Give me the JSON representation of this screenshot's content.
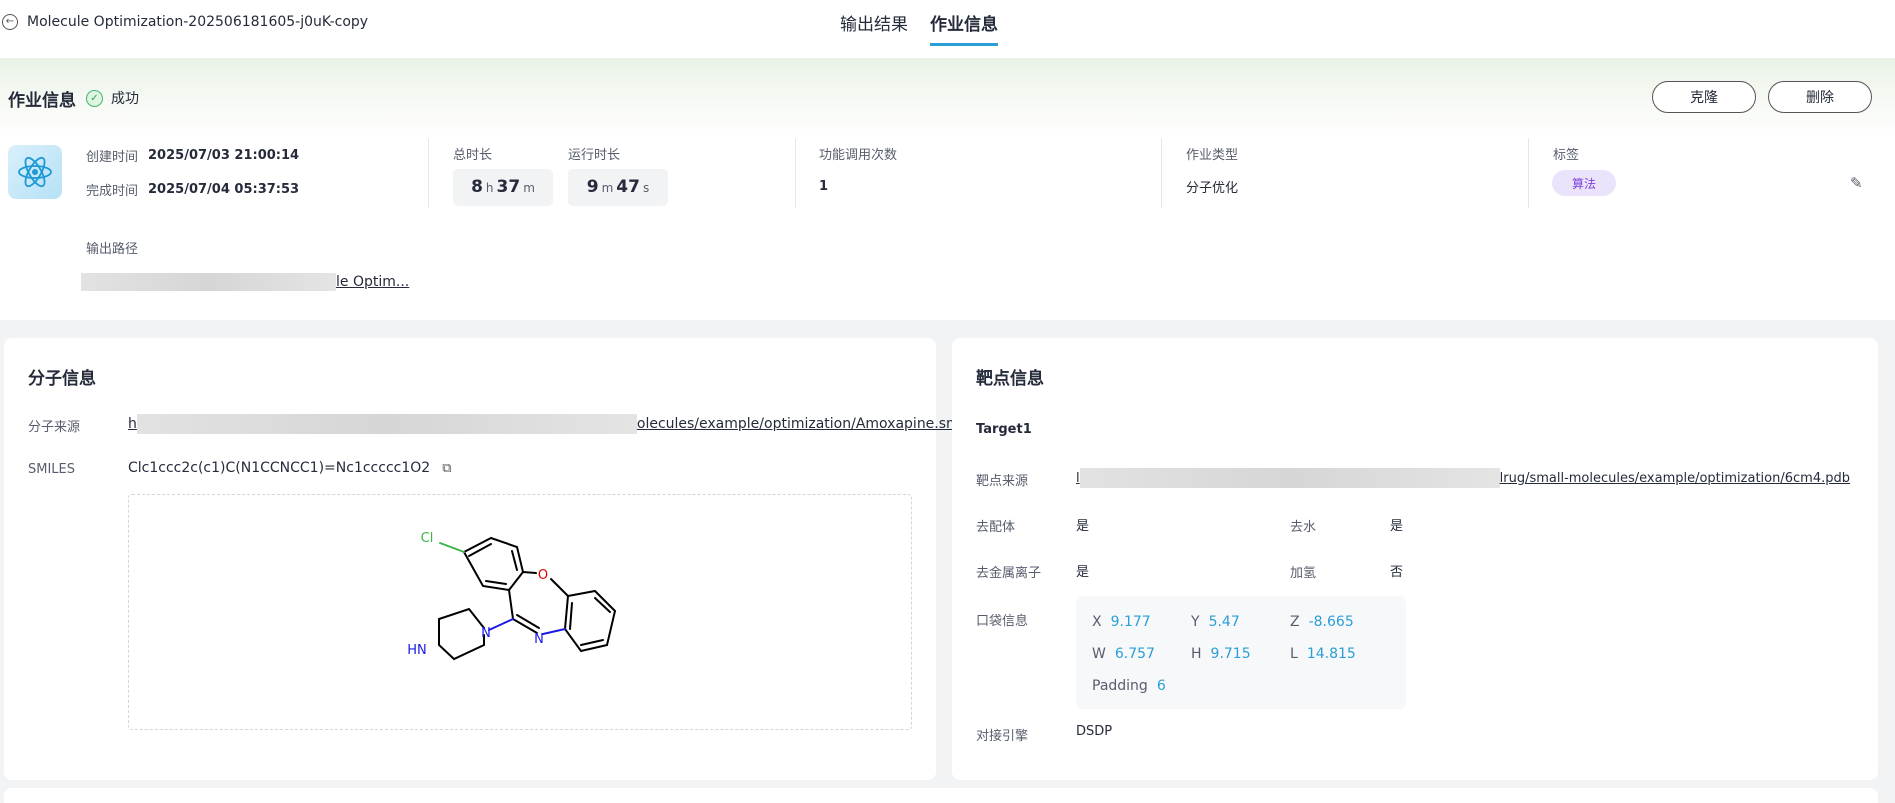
{
  "header": {
    "back_title": "Molecule Optimization-202506181605-j0uK-copy",
    "tabs": [
      {
        "label": "输出结果",
        "active": false
      },
      {
        "label": "作业信息",
        "active": true
      }
    ]
  },
  "job": {
    "title": "作业信息",
    "status": "成功",
    "status_color": "#3fb86a",
    "clone_label": "克隆",
    "delete_label": "删除",
    "icon": "atom-icon",
    "created_label": "创建时间",
    "created_value": "2025/07/03 21:00:14",
    "finished_label": "完成时间",
    "finished_value": "2025/07/04 05:37:53",
    "total_duration_label": "总时长",
    "total_duration": {
      "h": "8",
      "h_unit": "h",
      "m": "37",
      "m_unit": "m"
    },
    "run_duration_label": "运行时长",
    "run_duration": {
      "m": "9",
      "m_unit": "m",
      "s": "47",
      "s_unit": "s"
    },
    "calls_label": "功能调用次数",
    "calls_value": "1",
    "type_label": "作业类型",
    "type_value": "分子优化",
    "tags_label": "标签",
    "tag": "算法",
    "tag_color": "#7a45d8",
    "output_path_label": "输出路径",
    "output_path_visible": "le Optim..."
  },
  "molecule": {
    "title": "分子信息",
    "source_label": "分子来源",
    "source_prefix": "h",
    "source_suffix": "olecules/example/optimization/Amoxapine.smi",
    "smiles_label": "SMILES",
    "smiles_value": "Clc1ccc2c(c1)C(N1CCNCC1)=Nc1ccccc1O2",
    "atoms": {
      "cl": "Cl",
      "o": "O",
      "n1": "N",
      "n2": "N",
      "nh": "HN"
    }
  },
  "target": {
    "title": "靶点信息",
    "name": "Target1",
    "source_label": "靶点来源",
    "source_prefix": "l",
    "source_suffix": "lrug/small-molecules/example/optimization/6cm4.pdb",
    "remove_ligand_label": "去配体",
    "remove_ligand_value": "是",
    "remove_water_label": "去水",
    "remove_water_value": "是",
    "remove_metal_label": "去金属离子",
    "remove_metal_value": "是",
    "add_h_label": "加氢",
    "add_h_value": "否",
    "pocket_label": "口袋信息",
    "pocket": {
      "x_label": "X",
      "x": "9.177",
      "y_label": "Y",
      "y": "5.47",
      "z_label": "Z",
      "z": "-8.665",
      "w_label": "W",
      "w": "6.757",
      "h_label": "H",
      "h": "9.715",
      "l_label": "L",
      "l": "14.815",
      "padding_label": "Padding",
      "padding": "6"
    },
    "engine_label": "对接引擎",
    "engine_value": "DSDP"
  }
}
